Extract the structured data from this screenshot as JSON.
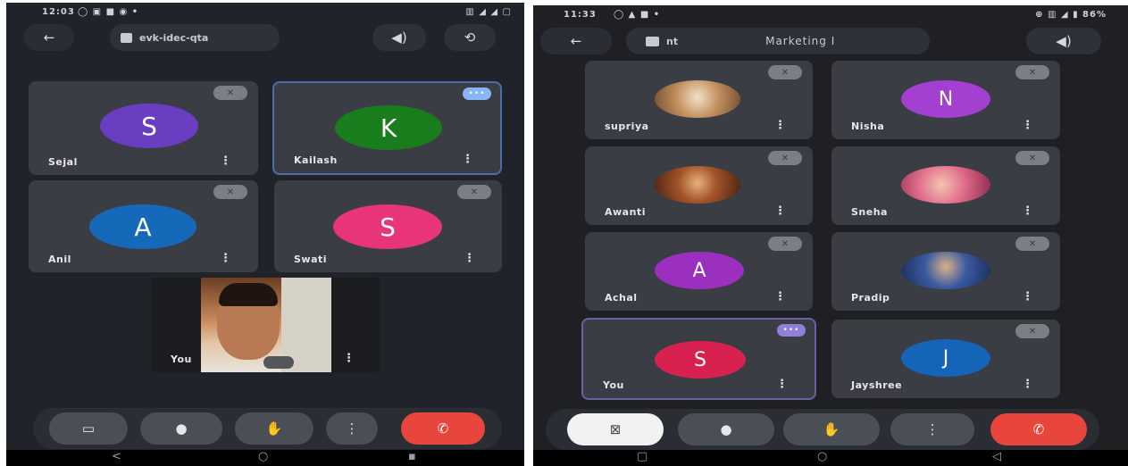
{
  "left": {
    "status": {
      "time": "12:03",
      "icons": "◯ ▣ ■ ◉ •",
      "right": "▥ ◢ ◢ ▢"
    },
    "meeting": {
      "code": "evk-idec-qta",
      "back": "←",
      "speaker": "◀)",
      "flip": "⟲"
    },
    "tiles": [
      {
        "name": "Sejal",
        "letter": "S",
        "color": "#6a3ec1"
      },
      {
        "name": "Kailash",
        "letter": "K",
        "color": "#1a7d1d"
      },
      {
        "name": "Anil",
        "letter": "A",
        "color": "#1668b8"
      },
      {
        "name": "Swati",
        "letter": "S",
        "color": "#e8347a"
      }
    ],
    "self": {
      "name": "You"
    },
    "mic_off": "✕",
    "speaking": "•••",
    "more": "⋮",
    "controls": {
      "camera": "▭",
      "mic": "●",
      "hand": "✋",
      "more": "⋮",
      "hangup": "✆"
    },
    "nav": {
      "back": "<",
      "home": "○",
      "recents": "▪"
    }
  },
  "right": {
    "status": {
      "time": "11:33",
      "icons": "◯ ▲ ■ •",
      "right": "⊕ ▥ ◢ ▮ 86%"
    },
    "meeting": {
      "code": "nt",
      "title": "Marketing I",
      "back": "←",
      "speaker": "◀)"
    },
    "tiles": [
      {
        "name": "supriya",
        "type": "photo",
        "color": "#b88a5a"
      },
      {
        "name": "Nisha",
        "letter": "N",
        "color": "#a33fd1"
      },
      {
        "name": "Awanti",
        "type": "photo",
        "color": "#8a3a1c"
      },
      {
        "name": "Sneha",
        "type": "photo",
        "color": "#d95a7a"
      },
      {
        "name": "Achal",
        "letter": "A",
        "color": "#9a2fc0"
      },
      {
        "name": "Pradip",
        "type": "photo",
        "color": "#2b4a8a"
      },
      {
        "name": "You",
        "letter": "S",
        "color": "#d8214e"
      },
      {
        "name": "Jayshree",
        "letter": "J",
        "color": "#1464b8"
      }
    ],
    "mic_off": "✕",
    "speaking": "•••",
    "more": "⋮",
    "controls": {
      "camera": "⊠",
      "mic": "●",
      "hand": "✋",
      "more": "⋮",
      "hangup": "✆"
    },
    "nav": {
      "recents": "▢",
      "home": "○",
      "back": "◁"
    }
  }
}
